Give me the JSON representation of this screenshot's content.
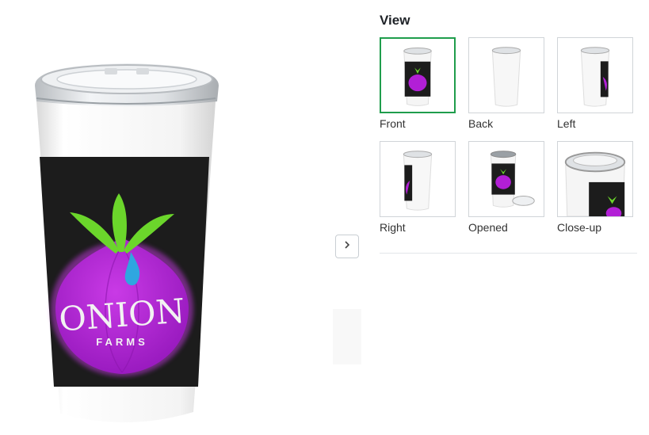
{
  "product": {
    "logo_word": "ONION",
    "logo_subword": "FARMS"
  },
  "gallery": {
    "title": "View",
    "thumbnails": [
      {
        "label": "Front",
        "selected": true
      },
      {
        "label": "Back",
        "selected": false
      },
      {
        "label": "Left",
        "selected": false
      },
      {
        "label": "Right",
        "selected": false
      },
      {
        "label": "Opened",
        "selected": false
      },
      {
        "label": "Close-up",
        "selected": false
      }
    ],
    "next_icon": "chevron-right-icon"
  },
  "colors": {
    "selected_border": "#1f9d4c",
    "onion": "#b21fd6",
    "leaf": "#6bd62b",
    "drop": "#2fa6e0",
    "wrap": "#1c1c1c"
  }
}
